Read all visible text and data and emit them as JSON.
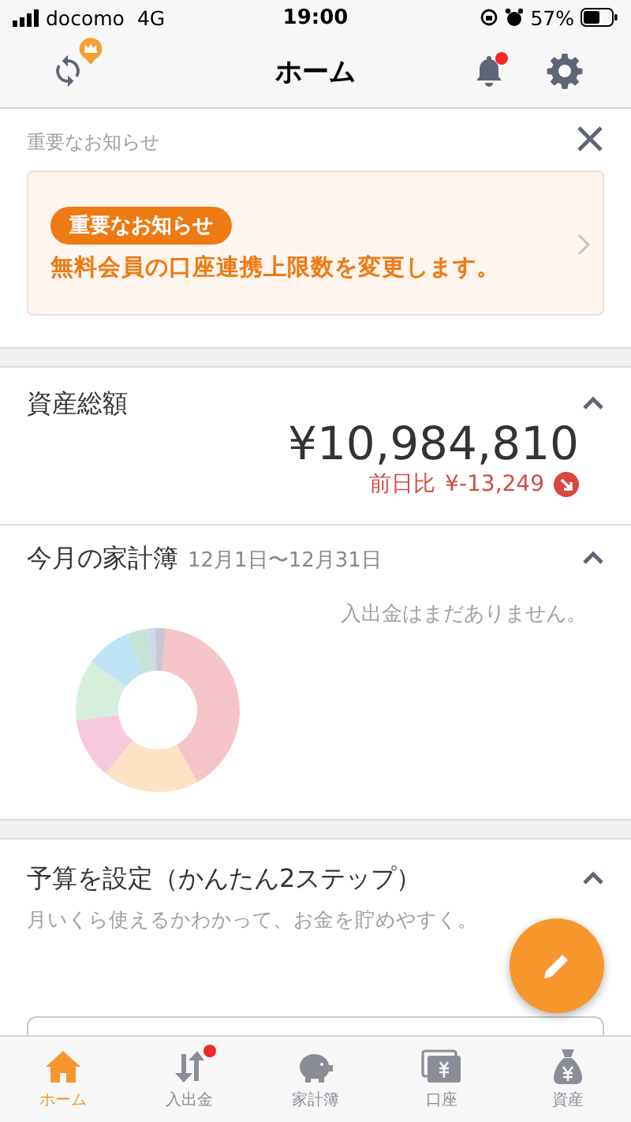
{
  "status_bar": {
    "carrier": "docomo",
    "network": "4G",
    "time": "19:00",
    "battery": "57%"
  },
  "header": {
    "title": "ホーム",
    "notification_badge": true,
    "premium_badge": true
  },
  "notice": {
    "heading": "重要なお知らせ",
    "tag": "重要なお知らせ",
    "message": "無料会員の口座連携上限数を変更します。"
  },
  "assets": {
    "title": "資産総額",
    "total": "¥10,984,810",
    "change_label": "前日比",
    "change": "¥-13,249",
    "trend_down": true
  },
  "household": {
    "title": "今月の家計簿",
    "period": "12月1日〜12月31日",
    "empty_message": "入出金はまだありません。"
  },
  "budget": {
    "title": "予算を設定（かんたん2ステップ）",
    "subtitle": "月いくら使えるかわかって、お金を貯めやすく。"
  },
  "tabs": [
    {
      "kind": "home",
      "label": "ホーム",
      "selected": true,
      "badge": false
    },
    {
      "kind": "transfer",
      "label": "入出金",
      "selected": false,
      "badge": true
    },
    {
      "kind": "piggy",
      "label": "家計簿",
      "selected": false,
      "badge": false
    },
    {
      "kind": "wallet",
      "label": "口座",
      "selected": false,
      "badge": false
    },
    {
      "kind": "bag",
      "label": "資産",
      "selected": false,
      "badge": false
    }
  ]
}
